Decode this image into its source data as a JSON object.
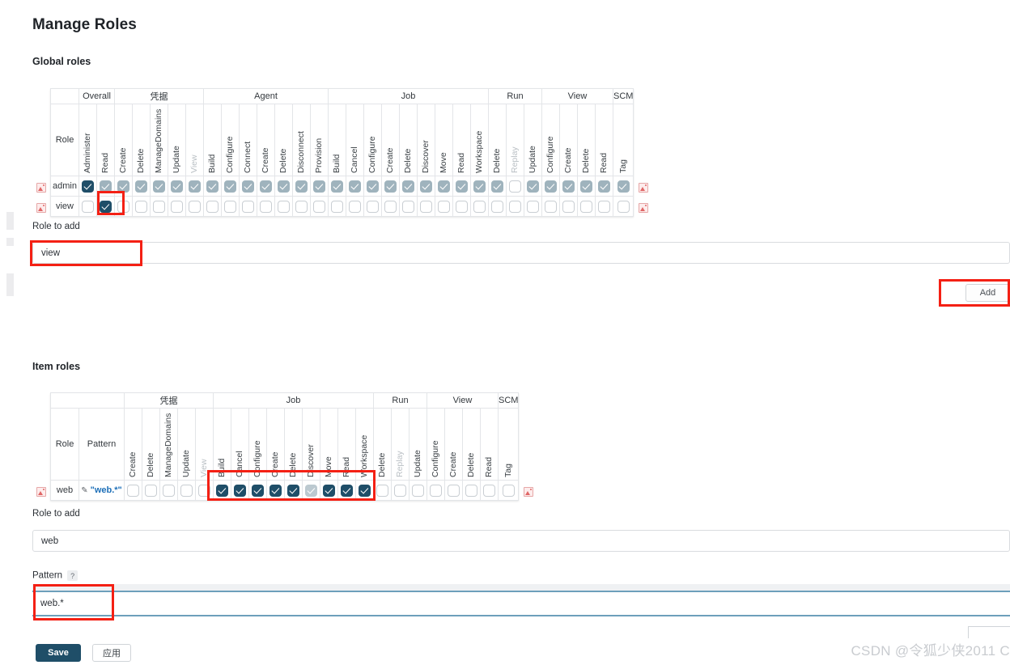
{
  "page": {
    "title": "Manage Roles"
  },
  "sections": {
    "global": {
      "heading": "Global roles"
    },
    "item": {
      "heading": "Item roles"
    }
  },
  "global_table": {
    "corner_label": "Role",
    "groups": [
      {
        "label": "Overall",
        "span": 2
      },
      {
        "label": "凭据",
        "span": 5
      },
      {
        "label": "Agent",
        "span": 7
      },
      {
        "label": "Job",
        "span": 9
      },
      {
        "label": "Run",
        "span": 3
      },
      {
        "label": "View",
        "span": 4
      },
      {
        "label": "SCM",
        "span": 1
      }
    ],
    "columns": [
      "Administer",
      "Read",
      "Create",
      "Delete",
      "ManageDomains",
      "Update",
      "View",
      "Build",
      "Configure",
      "Connect",
      "Create",
      "Delete",
      "Disconnect",
      "Provision",
      "Build",
      "Cancel",
      "Configure",
      "Create",
      "Delete",
      "Discover",
      "Move",
      "Read",
      "Workspace",
      "Delete",
      "Replay",
      "Update",
      "Configure",
      "Create",
      "Delete",
      "Read",
      "Tag"
    ],
    "faded_columns": [
      "View",
      "Replay"
    ],
    "rows": [
      {
        "role": "admin",
        "states": [
          "on",
          "dim",
          "dim",
          "dim",
          "dim",
          "dim",
          "dim",
          "dim",
          "dim",
          "dim",
          "dim",
          "dim",
          "dim",
          "dim",
          "dim",
          "dim",
          "dim",
          "dim",
          "dim",
          "dim",
          "dim",
          "dim",
          "dim",
          "dim",
          "off",
          "dim",
          "dim",
          "dim",
          "dim",
          "dim",
          "dim"
        ]
      },
      {
        "role": "view",
        "states": [
          "off",
          "on",
          "off",
          "off",
          "off",
          "off",
          "off",
          "off",
          "off",
          "off",
          "off",
          "off",
          "off",
          "off",
          "off",
          "off",
          "off",
          "off",
          "off",
          "off",
          "off",
          "off",
          "off",
          "off",
          "off",
          "off",
          "off",
          "off",
          "off",
          "off",
          "off"
        ]
      }
    ]
  },
  "item_table": {
    "corner_label": "Role",
    "pattern_label": "Pattern",
    "groups": [
      {
        "label": "凭据",
        "span": 5
      },
      {
        "label": "Job",
        "span": 9
      },
      {
        "label": "Run",
        "span": 3
      },
      {
        "label": "View",
        "span": 4
      },
      {
        "label": "SCM",
        "span": 1
      }
    ],
    "columns": [
      "Create",
      "Delete",
      "ManageDomains",
      "Update",
      "View",
      "Build",
      "Cancel",
      "Configure",
      "Create",
      "Delete",
      "Discover",
      "Move",
      "Read",
      "Workspace",
      "Delete",
      "Replay",
      "Update",
      "Configure",
      "Create",
      "Delete",
      "Read",
      "Tag"
    ],
    "faded_columns": [
      "View",
      "Replay"
    ],
    "rows": [
      {
        "role": "web",
        "pattern": "\"web.*\"",
        "states": [
          "off",
          "off",
          "off",
          "off",
          "off",
          "on",
          "on",
          "on",
          "on",
          "on",
          "pale",
          "on",
          "on",
          "on",
          "off",
          "off",
          "off",
          "off",
          "off",
          "off",
          "off",
          "off"
        ]
      }
    ]
  },
  "global_form": {
    "role_to_add_label": "Role to add",
    "role_to_add_value": "view",
    "role_to_add_placeholder": "",
    "add_button": "Add"
  },
  "item_form": {
    "role_to_add_label": "Role to add",
    "role_to_add_value": "web",
    "role_to_add_placeholder": "",
    "pattern_label": "Pattern",
    "pattern_help": "?",
    "pattern_value": "web.*",
    "pattern_placeholder": ""
  },
  "footer": {
    "save_label": "Save",
    "apply_label": "应用"
  },
  "watermark": {
    "text": "CSDN @令狐少侠2011  C"
  },
  "colors": {
    "accent": "#1f4e68",
    "annotation": "#f42014",
    "link": "#1d6fb8",
    "checkbox_dim": "#9fb3bd"
  }
}
